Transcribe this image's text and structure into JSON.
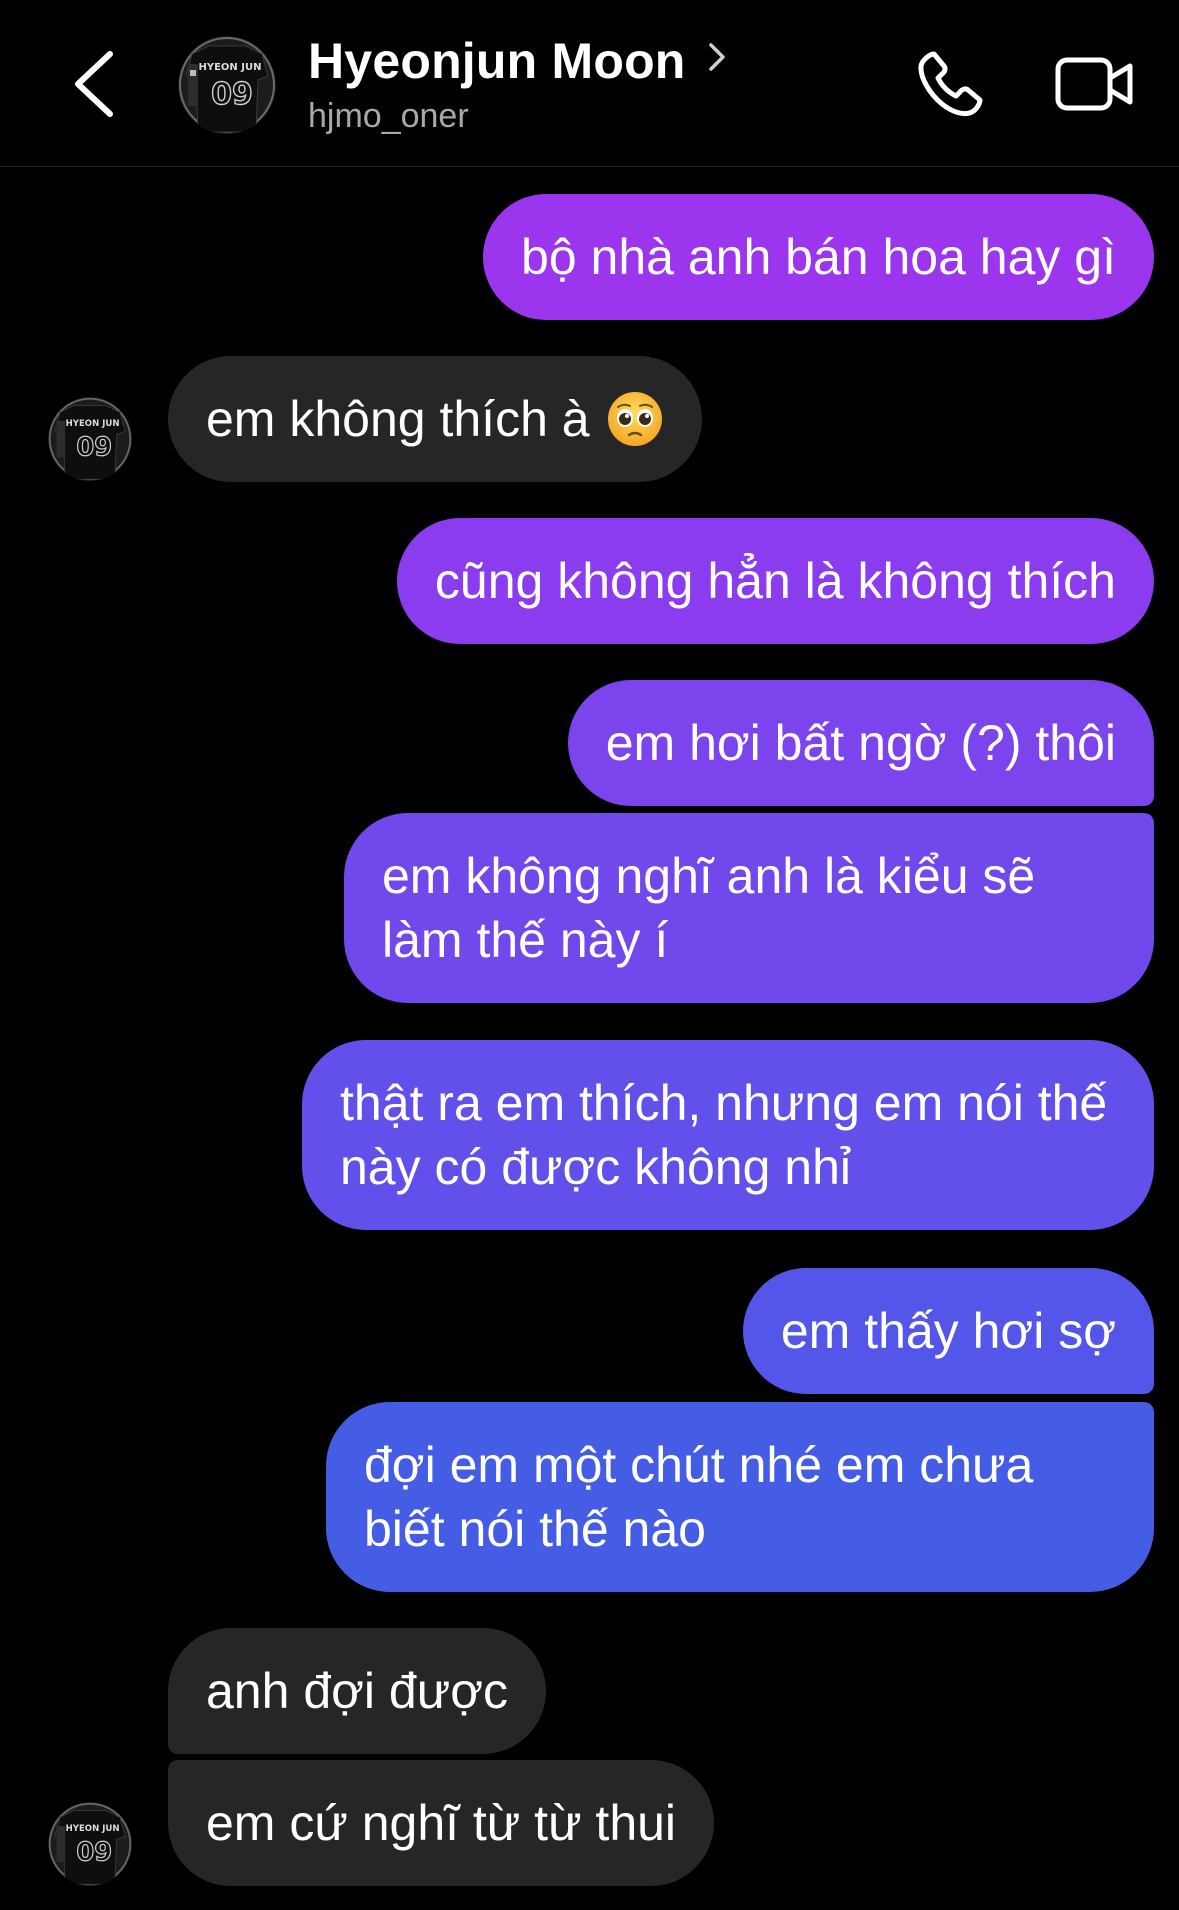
{
  "header": {
    "contact_name": "Hyeonjun Moon",
    "username": "hjmo_oner",
    "avatar_text_top": "HYEON JUN",
    "avatar_text_num": "09"
  },
  "messages": [
    {
      "sender": "me",
      "text": "bộ nhà anh bán hoa hay gì"
    },
    {
      "sender": "them",
      "text": "em không thích à",
      "emoji": "pleading-face"
    },
    {
      "sender": "me",
      "text": "cũng không hẳn là không thích"
    },
    {
      "sender": "me",
      "text": "em hơi bất ngờ (?) thôi"
    },
    {
      "sender": "me",
      "text": "em không nghĩ anh là kiểu sẽ làm thế này í"
    },
    {
      "sender": "me",
      "text": "thật ra em thích, nhưng em nói thế này có được không nhỉ"
    },
    {
      "sender": "me",
      "text": "em thấy hơi sợ"
    },
    {
      "sender": "me",
      "text": "đợi em một chút nhé em chưa biết nói thế nào"
    },
    {
      "sender": "them",
      "text": "anh đợi được"
    },
    {
      "sender": "them",
      "text": "em cứ nghĩ từ từ thui"
    }
  ],
  "colors": {
    "background": "#000000",
    "incoming_bubble": "#262626",
    "outgoing_top": "#9b35ee",
    "outgoing_bottom": "#3f5ee3",
    "secondary_text": "#a8a8a8"
  }
}
